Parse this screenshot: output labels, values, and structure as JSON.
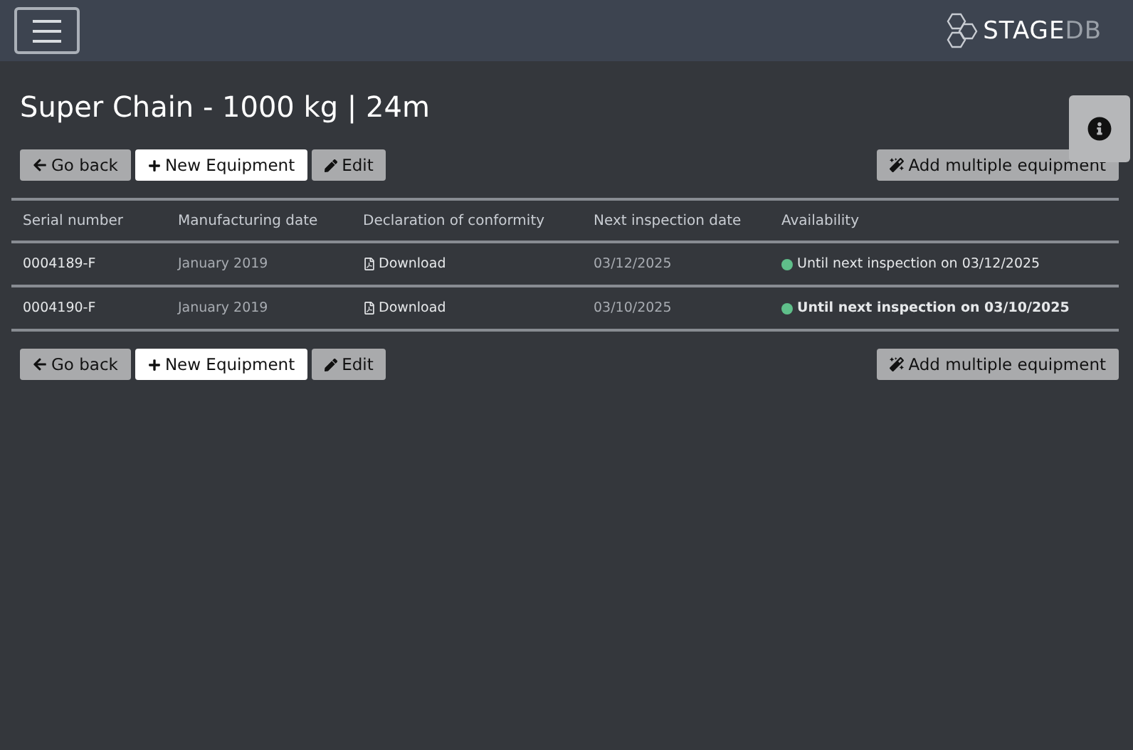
{
  "header": {
    "logo_main": "STAGE",
    "logo_accent": "DB"
  },
  "title": "Super Chain - 1000 kg | 24m",
  "toolbar": {
    "go_back": "Go back",
    "new_equipment": "New Equipment",
    "edit": "Edit",
    "add_multiple": "Add multiple equipment"
  },
  "table": {
    "columns": [
      "Serial number",
      "Manufacturing date",
      "Declaration of conformity",
      "Next inspection date",
      "Availability"
    ],
    "rows": [
      {
        "serial": "0004189-F",
        "manufactured": "January 2019",
        "declaration": "Download",
        "next_inspection": "03/12/2025",
        "availability": "Until next inspection on 03/12/2025",
        "color": "#5fbf8a",
        "bold": false
      },
      {
        "serial": "0004190-F",
        "manufactured": "January 2019",
        "declaration": "Download",
        "next_inspection": "03/10/2025",
        "availability": "Until next inspection on 03/10/2025",
        "color": "#5fbf8a",
        "bold": true
      }
    ]
  },
  "toolbar_bottom": {
    "go_back": "Go back",
    "new_equipment": "New Equipment",
    "edit": "Edit",
    "add_multiple": "Add multiple equipment"
  }
}
